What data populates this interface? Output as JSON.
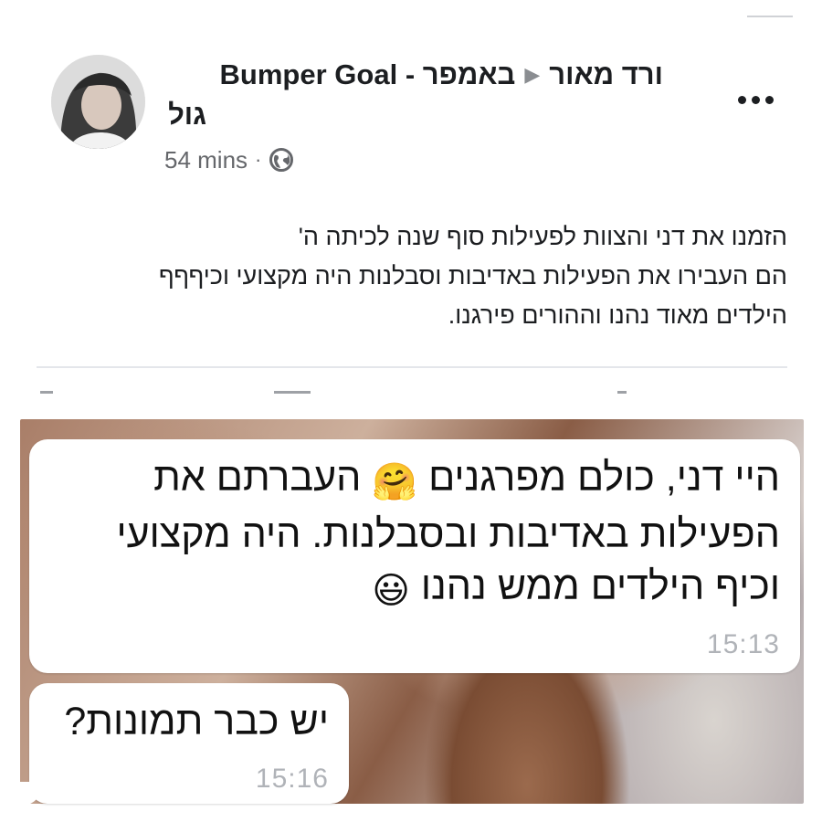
{
  "post": {
    "author": "ורד מאור",
    "group_name": "באמפר - Bumper Goal",
    "group_name_cont": "גול",
    "timestamp": "54 mins",
    "separator": "·",
    "privacy_icon": "globe-icon",
    "more_icon": "more-options-icon",
    "text_lines": [
      "הזמנו את דני והצוות לפעילות סוף שנה לכיתה ה'",
      "הם העבירו את הפעילות באדיבות וסבלנות היה מקצועי וכיףףף",
      "הילדים מאוד נהנו וההורים פירגנו."
    ]
  },
  "chat": {
    "message1": {
      "line1": "היי דני, כולם מפרגנים",
      "emoji1": "🤗",
      "line1_end": "העברתם את",
      "line2": "הפעילות באדיבות ובסבלנות. היה   מקצועי",
      "line3": "וכיף הילדים ממש נהנו",
      "emoji2": "😃",
      "time": "15:13"
    },
    "message2": {
      "text": "יש כבר תמונות?",
      "time": "15:16"
    }
  },
  "colors": {
    "text": "#1c1e21",
    "muted": "#65676b",
    "timestamp": "#b0b3b8",
    "bubble": "#ffffff"
  }
}
